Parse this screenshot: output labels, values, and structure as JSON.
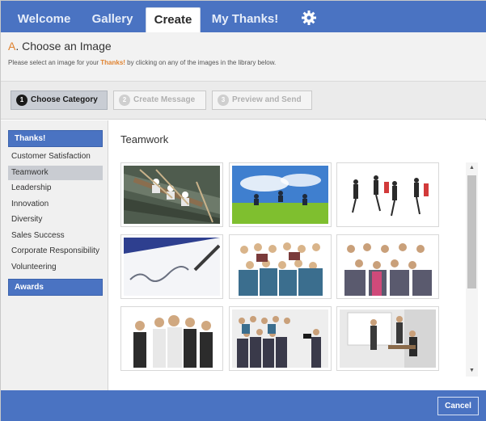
{
  "nav": {
    "tabs": [
      {
        "label": "Welcome"
      },
      {
        "label": "Gallery"
      },
      {
        "label": "Create"
      },
      {
        "label": "My Thanks!"
      }
    ],
    "active_tab": "Create",
    "settings_icon": "gear-icon"
  },
  "header": {
    "step_letter": "A",
    "title": ". Choose an Image",
    "sub_before": "Please select an image for your ",
    "sub_highlight": "Thanks!",
    "sub_after": " by clicking on any of the images in the library below."
  },
  "steps": [
    {
      "num": "1",
      "label": "Choose Category",
      "state": "current"
    },
    {
      "num": "2",
      "label": "Create Message",
      "state": "disabled"
    },
    {
      "num": "3",
      "label": "Preview and Send",
      "state": "disabled"
    }
  ],
  "sidebar": {
    "thanks_header": "Thanks!",
    "items": [
      {
        "label": "Customer Satisfaction"
      },
      {
        "label": "Teamwork",
        "selected": true
      },
      {
        "label": "Leadership"
      },
      {
        "label": "Innovation"
      },
      {
        "label": "Diversity"
      },
      {
        "label": "Sales Success"
      },
      {
        "label": "Corporate Responsibility"
      },
      {
        "label": "Volunteering"
      }
    ],
    "awards_header": "Awards"
  },
  "content": {
    "category_title": "Teamwork"
  },
  "footer": {
    "cancel_label": "Cancel"
  },
  "colors": {
    "brand_blue": "#4a73c2",
    "accent_orange": "#e0822f"
  }
}
